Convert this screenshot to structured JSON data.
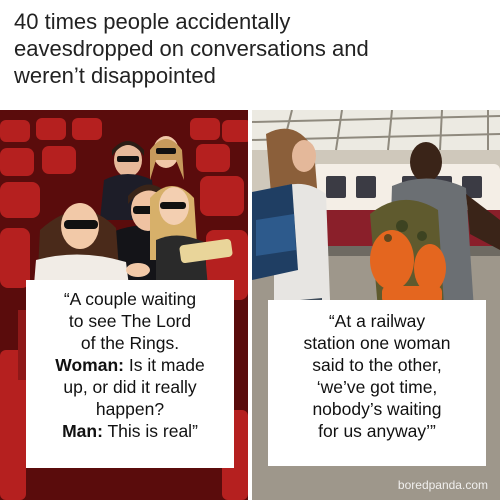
{
  "headline": {
    "line1": "40 times people accidentally",
    "line2": "eavesdropped on conversations and",
    "line3": "weren’t disappointed"
  },
  "left_caption": {
    "line1": "“A couple waiting",
    "line2": "to see The Lord",
    "line3": "of the Rings.",
    "woman_speaker": "Woman:",
    "woman_line_a": " Is it made",
    "woman_line_b": "up, or did it really",
    "woman_line_c": "happen?",
    "man_speaker": "Man:",
    "man_line": " This is real”"
  },
  "right_caption": {
    "line1": "“At a railway",
    "line2": "station one woman",
    "line3": "said to the other,",
    "line4": "‘we’ve got time,",
    "line5": "nobody’s waiting",
    "line6": "for us anyway’”"
  },
  "watermark": "boredpanda.com",
  "colors": {
    "cinema_seat": "#b5201f",
    "train_red": "#8a1f2a",
    "backpack_orange": "#e4661f"
  }
}
